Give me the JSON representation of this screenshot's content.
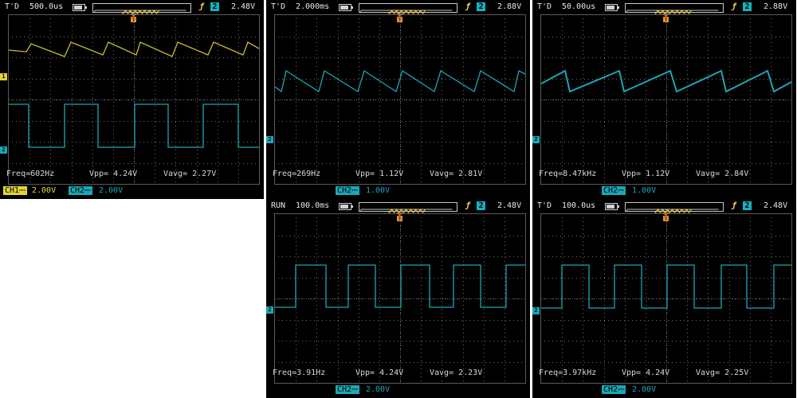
{
  "colors": {
    "ch1": "#d8c93a",
    "ch2": "#19a7b6",
    "trigger": "#f08a2a",
    "background": "#000000"
  },
  "panels": [
    {
      "run_state": "T'D",
      "timebase": "500.0us",
      "trig_slope": "ƒ",
      "trig_source": "2",
      "trig_level": "2.48V",
      "freq": "Freq=602Hz",
      "vpp": "Vpp= 4.24V",
      "vavg": "Vavg= 2.27V",
      "ch1_label": "CH1⎓",
      "ch1_scale": "2.00V",
      "ch2_label": "CH2⎓",
      "ch2_scale": "2.00V",
      "waves": [
        "ch1-sawtooth",
        "ch2-square"
      ],
      "square_edges": [
        0.0,
        0.08,
        0.21,
        0.36,
        0.5,
        0.64,
        0.78,
        0.92,
        1.0
      ]
    },
    {
      "run_state": "T'D",
      "timebase": "2.000ms",
      "trig_slope": "ƒ",
      "trig_source": "2",
      "trig_level": "2.88V",
      "freq": "Freq=269Hz",
      "vpp": "Vpp= 1.12V",
      "vavg": "Vavg= 2.81V",
      "ch2_label": "CH2⎓",
      "ch2_scale": "1.00V",
      "waves": [
        "ch2-sawtooth"
      ]
    },
    {
      "run_state": "T'D",
      "timebase": "50.00us",
      "trig_slope": "ƒ",
      "trig_source": "2",
      "trig_level": "2.88V",
      "freq": "Freq=8.47kHz",
      "vpp": "Vpp= 1.12V",
      "vavg": "Vavg= 2.84V",
      "ch2_label": "CH2⎓",
      "ch2_scale": "1.00V",
      "waves": [
        "ch2-sawtooth-slow"
      ]
    },
    {
      "run_state": "RUN",
      "timebase": "100.0ms",
      "trig_slope": "ƒ",
      "trig_source": "2",
      "trig_level": "2.48V",
      "freq": "Freq=3.91Hz",
      "vpp": "Vpp= 4.24V",
      "vavg": "Vavg= 2.23V",
      "ch2_label": "CH2⎓",
      "ch2_scale": "2.00V",
      "waves": [
        "ch2-square-low"
      ]
    },
    {
      "run_state": "T'D",
      "timebase": "100.0us",
      "trig_slope": "ƒ",
      "trig_source": "2",
      "trig_level": "2.48V",
      "freq": "Freq=3.97kHz",
      "vpp": "Vpp= 4.24V",
      "vavg": "Vavg= 2.25V",
      "ch2_label": "CH2⎓",
      "ch2_scale": "2.00V",
      "waves": [
        "ch2-square-low"
      ]
    }
  ]
}
